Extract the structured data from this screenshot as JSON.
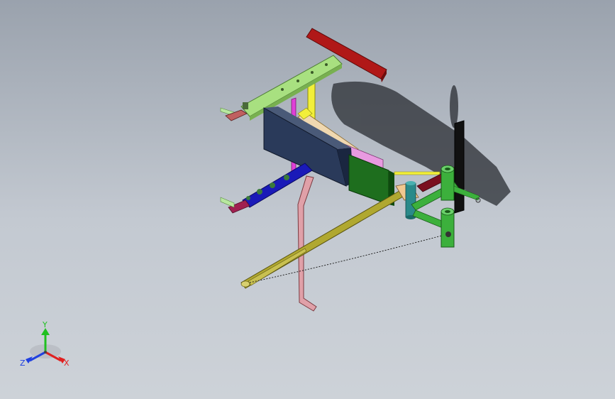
{
  "view": {
    "background_top": "#9aa2ad",
    "background_bottom": "#cdd2d8"
  },
  "triad": {
    "x_label": "X",
    "y_label": "Y",
    "z_label": "Z",
    "x_color": "#e02020",
    "y_color": "#20c020",
    "z_color": "#2040e0"
  },
  "parts": {
    "top_crossbar_color": "#b01818",
    "upper_arm_color": "#a8e080",
    "yellow_post_color": "#f2ef3a",
    "magenta_post_color": "#e040d8",
    "navy_pad_color": "#2a3a5a",
    "green_pad_color": "#1e6e1e",
    "blue_lower_arm_color": "#1a1ab8",
    "pink_leg_color": "#e0a0a8",
    "olive_strut_color": "#b0a830",
    "green_bracket_color": "#3cb03c",
    "black_post_color": "#111111",
    "teal_collar_color": "#2a8a8a"
  }
}
